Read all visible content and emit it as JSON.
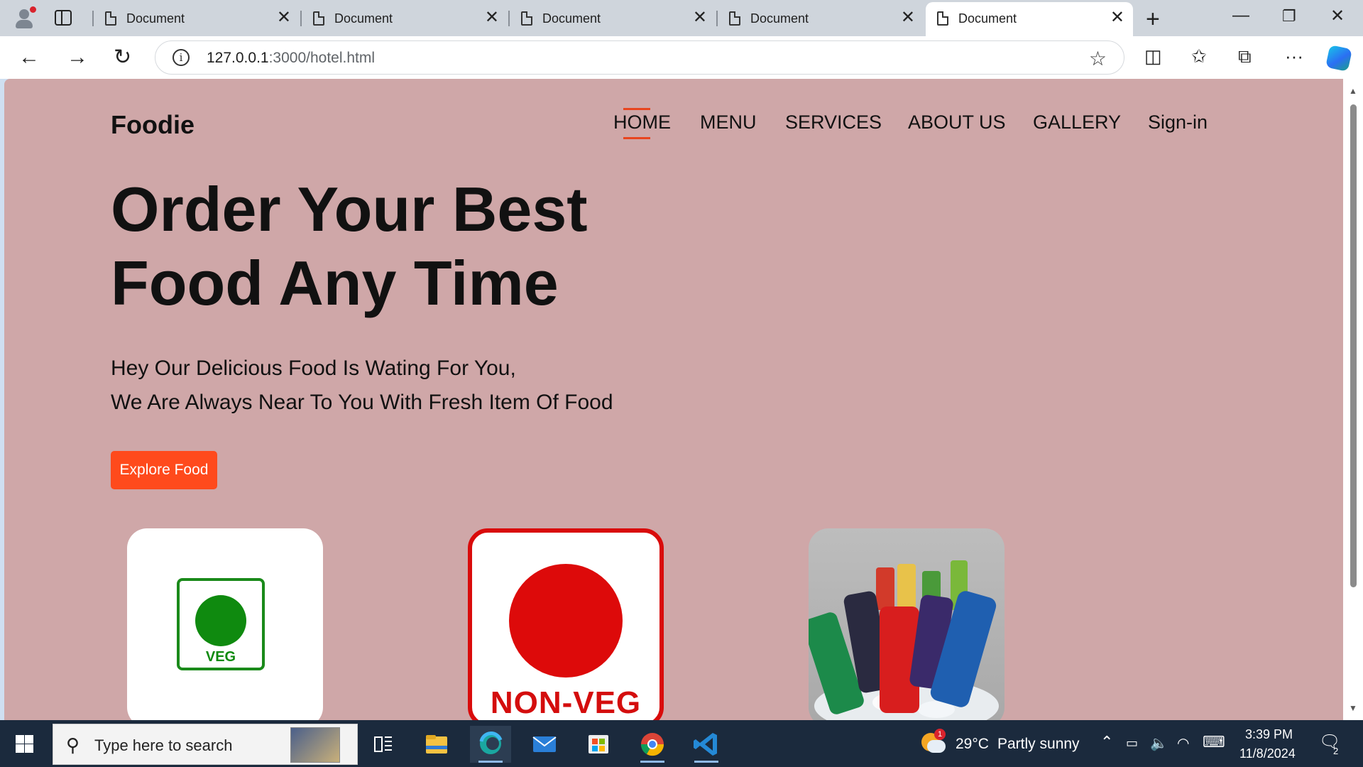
{
  "browser": {
    "tabs": [
      {
        "title": "Document",
        "close": "✕"
      },
      {
        "title": "Document",
        "close": "✕"
      },
      {
        "title": "Document",
        "close": "✕"
      },
      {
        "title": "Document",
        "close": "✕"
      },
      {
        "title": "Document",
        "close": "✕"
      }
    ],
    "active_tab_index": 4,
    "url_host": "127.0.0.1",
    "url_path": ":3000/hotel.html"
  },
  "page": {
    "logo": "Foodie",
    "nav": [
      "HOME",
      "MENU",
      "SERVICES",
      "ABOUT US",
      "GALLERY",
      "Sign-in"
    ],
    "active_nav": "HOME",
    "hero_title_line1": "Order Your Best",
    "hero_title_line2": "Food Any Time",
    "hero_sub_line1": "Hey Our Delicious Food Is Wating For You,",
    "hero_sub_line2": "We Are Always Near To You With Fresh Item Of Food",
    "cta": "Explore Food",
    "cards": [
      {
        "label": "VEG"
      },
      {
        "label": "NON-VEG"
      },
      {
        "image": "cold-drinks-cans-on-ice"
      }
    ],
    "accent_color": "#ff4a1c",
    "background_color": "#cfa7a8"
  },
  "taskbar": {
    "search_placeholder": "Type here to search",
    "weather_temp": "29°C",
    "weather_desc": "Partly sunny",
    "weather_badge": "1",
    "time": "3:39 PM",
    "date": "11/8/2024",
    "notification_count": "2"
  }
}
